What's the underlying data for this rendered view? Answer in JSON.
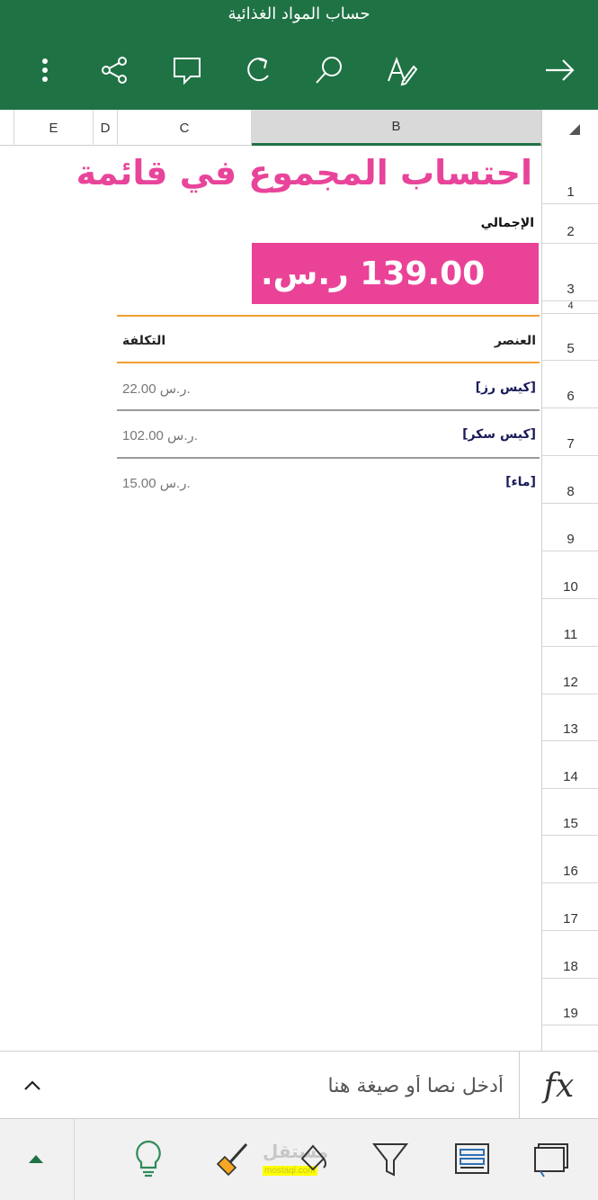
{
  "app": {
    "document_title": "حساب المواد الغذائية"
  },
  "toolbar": {
    "icons": [
      "more-vertical-icon",
      "share-icon",
      "comment-icon",
      "redo-icon",
      "search-icon",
      "edit-text-icon",
      "arrow-forward-icon"
    ]
  },
  "columns": [
    {
      "label": "E"
    },
    {
      "label": "D"
    },
    {
      "label": "C"
    },
    {
      "label": "B",
      "selected": true
    }
  ],
  "rows": [
    "1",
    "2",
    "3",
    "4",
    "5",
    "6",
    "7",
    "8",
    "9",
    "10",
    "11",
    "12",
    "13",
    "14",
    "15",
    "16",
    "17",
    "18",
    "19"
  ],
  "sheet": {
    "title": "احتساب المجموع في قائمة",
    "total_label": "الإجمالي",
    "total_value": "139.00 ر.س.",
    "header_item": "العنصر",
    "header_cost": "التكلفة",
    "items": [
      {
        "name": "[كيس رز]",
        "cost": "22.00 ر.س."
      },
      {
        "name": "[كيس سكر]",
        "cost": "102.00 ر.س."
      },
      {
        "name": "[ماء]",
        "cost": "15.00 ر.س."
      }
    ]
  },
  "formula_bar": {
    "placeholder": "أدخل نصا أو صيغة هنا",
    "fx_label": "fx"
  },
  "watermark": {
    "text": "مستقل",
    "sub": "mostaql.com"
  },
  "colors": {
    "accent_green": "#1f7244",
    "title_pink": "#e8449a",
    "total_fill": "#ea4297",
    "rule_orange": "#f0a030"
  }
}
